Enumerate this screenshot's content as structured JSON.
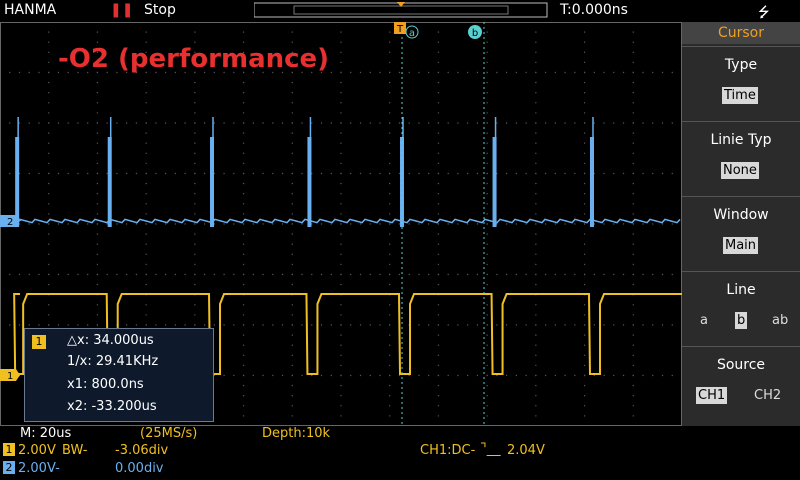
{
  "header": {
    "brand": "HANMA",
    "run_state": "Stop",
    "trigger_time": "T:0.000ns"
  },
  "overlay": {
    "title": "-O2 (performance)"
  },
  "cursor_markers": {
    "a_label": "a",
    "b_label": "b",
    "trigger_label": "T"
  },
  "channel_markers": {
    "ch1": "1",
    "ch2": "2"
  },
  "side_menu": {
    "title": "Cursor",
    "type": {
      "label": "Type",
      "value": "Time"
    },
    "line_type": {
      "label": "Linie Typ",
      "value": "None"
    },
    "window": {
      "label": "Window",
      "value": "Main"
    },
    "line": {
      "label": "Line",
      "options": [
        "a",
        "b",
        "ab"
      ],
      "selected": "b"
    },
    "source": {
      "label": "Source",
      "options": [
        "CH1",
        "CH2"
      ],
      "selected": "CH1"
    }
  },
  "measurement": {
    "channel": "1",
    "dx": "△x: 34.000us",
    "inv_dx": "1/x: 29.41KHz",
    "x1": "x1: 800.0ns",
    "x2": "x2: -33.200us"
  },
  "status": {
    "timebase": "M: 20us",
    "sample_rate": "(25MS/s)",
    "depth": "Depth:10k",
    "ch1_scale": "2.00V",
    "ch1_bw": "BW-",
    "ch1_offset": "-3.06div",
    "ch2_scale": "2.00V-",
    "ch2_offset": "0.00div",
    "trigger": "CH1:DC-",
    "trigger_level": "2.04V"
  },
  "colors": {
    "ch1": "#f0c020",
    "ch2": "#6ab0f0",
    "accent": "#f0a020",
    "title": "#e83030"
  },
  "waveform": {
    "ch1_pulse_times_us": [
      -158,
      -120,
      -78,
      -38,
      0,
      38,
      78,
      118
    ],
    "ch2_pulse_times_us": [
      -158,
      -120,
      -78,
      -38,
      0,
      38,
      78,
      118
    ]
  }
}
